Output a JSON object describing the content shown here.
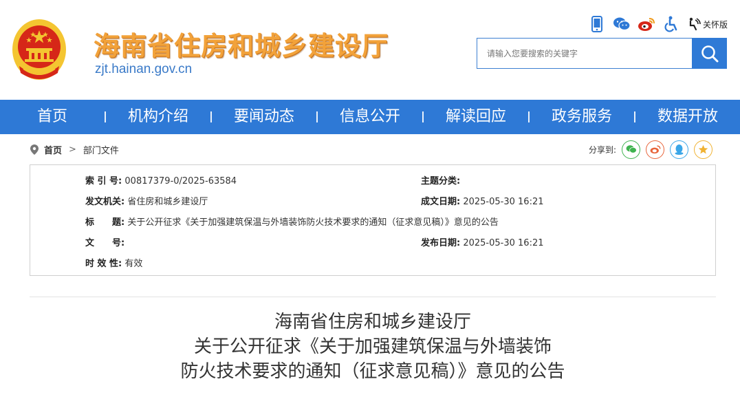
{
  "site": {
    "title": "海南省住房和城乡建设厅",
    "domain": "zjt.hainan.gov.cn"
  },
  "top_bar": {
    "icons": [
      "mobile-icon",
      "wechat-icon",
      "weibo-icon",
      "accessibility-icon"
    ],
    "elder_label": "关怀版"
  },
  "search": {
    "placeholder": "请输入您要搜索的关键字"
  },
  "nav": {
    "items": [
      "首页",
      "机构介绍",
      "要闻动态",
      "信息公开",
      "解读回应",
      "政务服务",
      "数据开放"
    ]
  },
  "breadcrumb": {
    "home": "首页",
    "separator": ">",
    "current": "部门文件"
  },
  "share": {
    "label": "分享到:"
  },
  "info": {
    "index_label": "索 引 号:",
    "index_value": "00817379-0/2025-63584",
    "topic_label": "主题分类:",
    "topic_value": "",
    "issuer_label": "发文机关:",
    "issuer_value": "省住房和城乡建设厅",
    "created_label": "成文日期:",
    "created_value": "2025-05-30 16:21",
    "title_label": "标　　题:",
    "title_value": "关于公开征求《关于加强建筑保温与外墙装饰防火技术要求的通知（征求意见稿）》意见的公告",
    "docno_label": "文　　号:",
    "docno_value": "",
    "published_label": "发布日期:",
    "published_value": "2025-05-30 16:21",
    "validity_label": "时 效 性:",
    "validity_value": "有效"
  },
  "article": {
    "title_line1": "海南省住房和城乡建设厅",
    "title_line2": "关于公开征求《关于加强建筑保温与外墙装饰",
    "title_line3": "防火技术要求的通知（征求意见稿）》意见的公告"
  },
  "colors": {
    "nav_blue": "#2e79d6",
    "title_orange": "#f2a23a",
    "emblem_red": "#d62718",
    "emblem_gold": "#f4c531"
  }
}
